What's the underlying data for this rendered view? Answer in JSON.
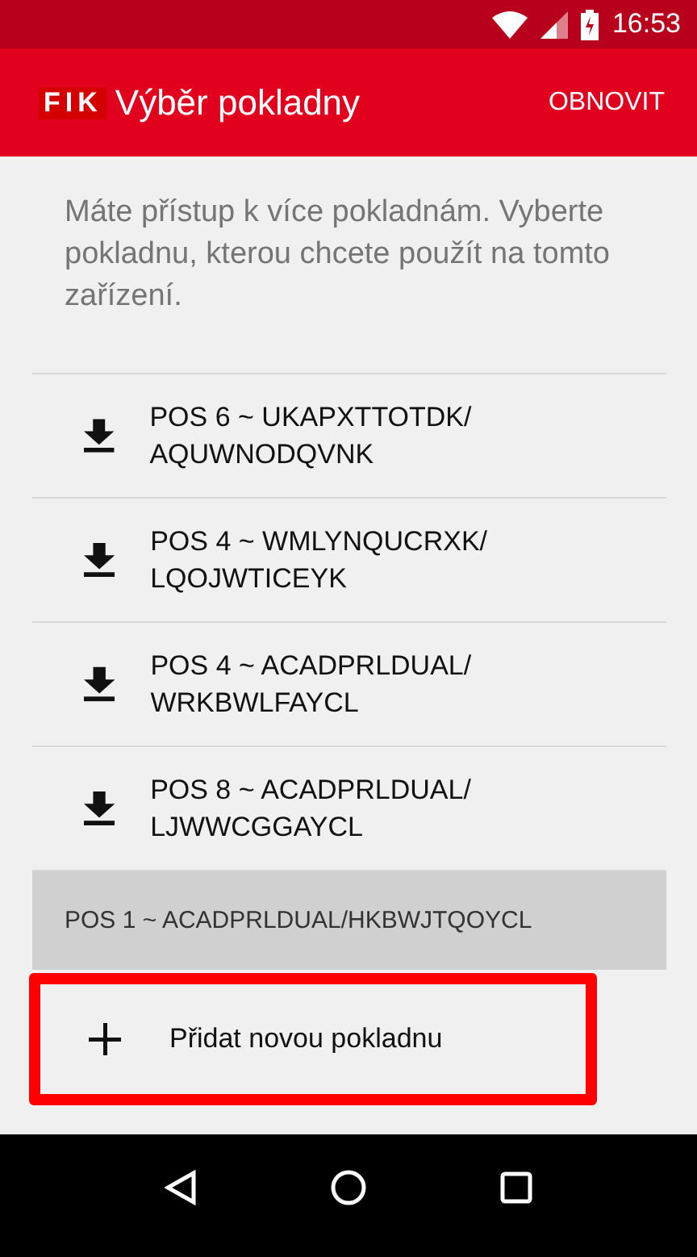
{
  "status_bar": {
    "time": "16:53"
  },
  "app_bar": {
    "logo": "FIK",
    "title": "Výběr pokladny",
    "action": "OBNOVIT"
  },
  "intro": "Máte přístup k více pokladnám. Vyberte pokladnu, kterou chcete použít na tomto zařízení.",
  "registers": [
    {
      "label": "POS 6 ~ UKAPXTTOTDK/ AQUWNODQVNK",
      "selected": false
    },
    {
      "label": "POS 4 ~ WMLYNQUCRXK/ LQOJWTICEYK",
      "selected": false
    },
    {
      "label": "POS 4 ~ ACADPRLDUAL/ WRKBWLFAYCL",
      "selected": false
    },
    {
      "label": "POS 8 ~ ACADPRLDUAL/ LJWWCGGAYCL",
      "selected": false
    },
    {
      "label": "POS 1 ~ ACADPRLDUAL/HKBWJTQOYCL",
      "selected": true
    }
  ],
  "add_button": {
    "label": "Přidat novou pokladnu",
    "highlighted": true
  }
}
